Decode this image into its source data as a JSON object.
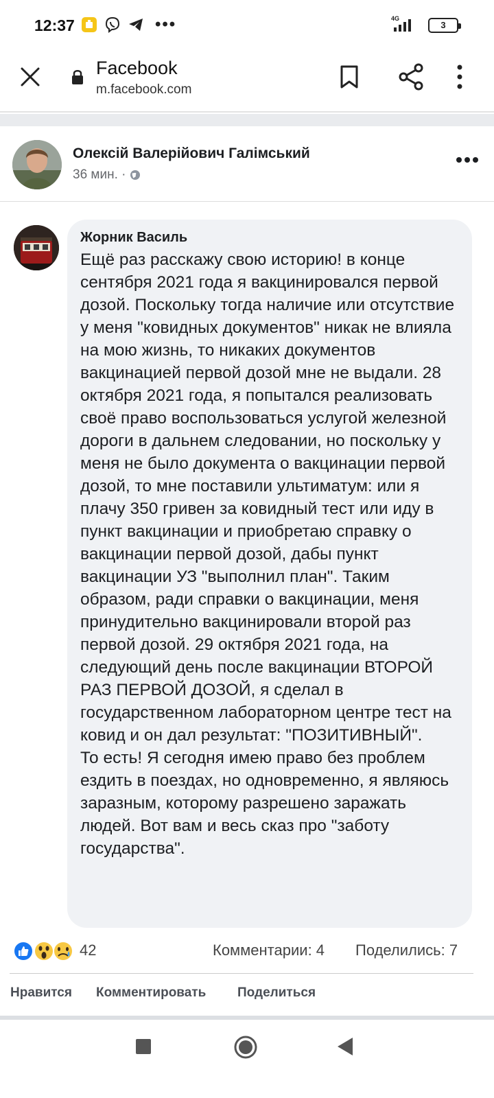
{
  "status_bar": {
    "time": "12:37",
    "network": "4G",
    "battery": "3",
    "more": "•••"
  },
  "browser": {
    "title": "Facebook",
    "url": "m.facebook.com"
  },
  "post": {
    "author": "Олексій Валерійович Галімський",
    "time": "36 мин. ·"
  },
  "comment": {
    "name": "Жорник Василь",
    "paragraphs": [
      "Ещё раз расскажу свою историю! в конце сентября 2021 года я вакцинировался первой дозой. Поскольку тогда наличие или отсутствие у меня \"ковидных документов\" никак не влияла на мою жизнь, то никаких документов вакцинацией первой дозой мне не выдали. 28 октября 2021 года, я попытался реализовать своё право воспользоваться услугой железной дороги в дальнем следовании, но поскольку у меня не было документа о вакцинации первой дозой, то мне поставили ультиматум: или я плачу 350 гривен за ковидный тест или иду в пункт вакцинации и приобретаю справку о вакцинации первой дозой, дабы пункт вакцинации УЗ \"выполнил план\". Таким образом, ради справки о вакцинации, меня принудительно вакцинировали второй раз первой дозой. 29 октября 2021 года, на следующий день после вакцинации ВТОРОЙ РАЗ ПЕРВОЙ ДОЗОЙ, я сделал в государственном лабораторном центре тест на ковид и он дал результат: \"ПОЗИТИВНЫЙ\".",
      "То есть! Я сегодня имею право без проблем ездить в поездах, но одновременно, я являюсь заразным, которому разрешено заражать людей. Вот вам и весь сказ про \"заботу государства\"."
    ]
  },
  "stats": {
    "reactions": "42",
    "comments": "Комментарии: 4",
    "shares": "Поделились: 7"
  },
  "actions": {
    "like": "Нравится",
    "comment": "Комментировать",
    "share": "Поделиться"
  },
  "colors": {
    "like_blue": "#1877f2",
    "wow_yellow": "#f7c843",
    "bubble_bg": "#f0f2f5"
  }
}
